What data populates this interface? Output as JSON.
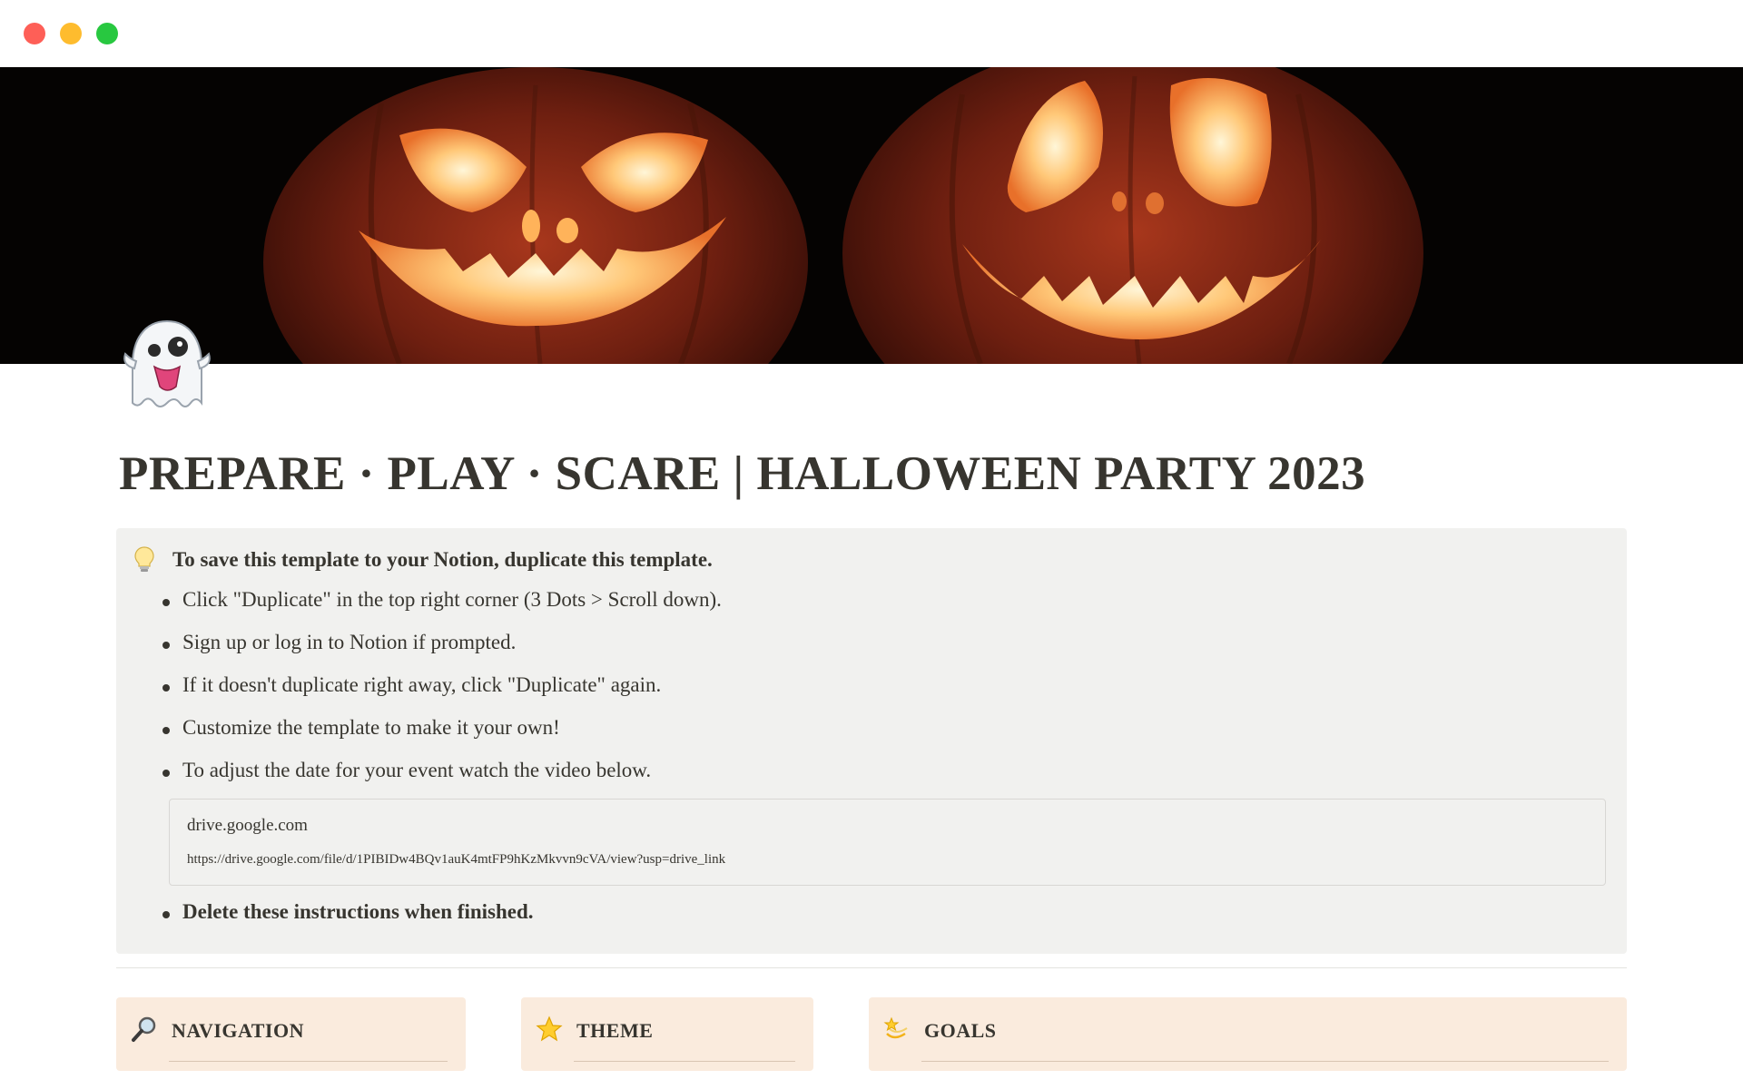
{
  "window": {
    "controls": [
      "close",
      "minimize",
      "zoom"
    ]
  },
  "cover": {
    "description_icon": "jack-o-lantern-cover"
  },
  "page": {
    "icon": "ghost-icon",
    "title": "PREPARE · PLAY · SCARE | HALLOWEEN PARTY 2023"
  },
  "callout": {
    "icon": "light-bulb-icon",
    "heading": "To save this template to your Notion, duplicate this template.",
    "items": [
      "Click \"Duplicate\" in the top right corner (3 Dots > Scroll down).",
      "Sign up or log in to Notion if prompted.",
      "If it doesn't duplicate right away, click \"Duplicate\" again.",
      "Customize the template to make it your own!",
      "To adjust the date for your event watch the video below."
    ],
    "bookmark": {
      "title": "drive.google.com",
      "url": "https://drive.google.com/file/d/1PIBIDw4BQv1auK4mtFP9hKzMkvvn9cVA/view?usp=drive_link"
    },
    "final_item": "Delete these instructions when finished."
  },
  "cards": [
    {
      "icon": "magnifying-glass-icon",
      "label": "NAVIGATION"
    },
    {
      "icon": "star-icon",
      "label": "THEME"
    },
    {
      "icon": "dizzy-star-icon",
      "label": "GOALS"
    }
  ],
  "colors": {
    "text": "#37352f",
    "callout_bg": "#f1f1ef",
    "card_bg": "#faebdd"
  }
}
